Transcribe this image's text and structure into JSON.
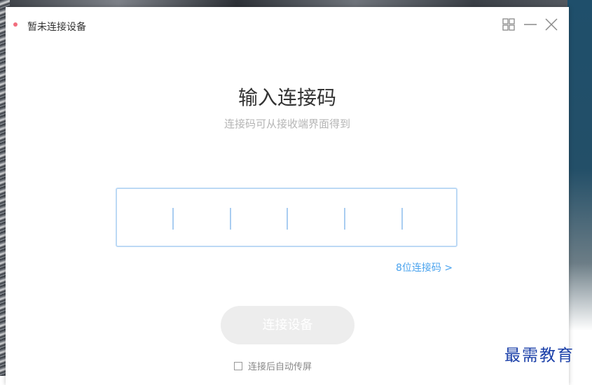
{
  "window": {
    "title": "暂未连接设备",
    "status_color": "#f26d7d",
    "controls": [
      "grid-icon",
      "minimize-icon",
      "close-icon"
    ]
  },
  "main": {
    "heading": "输入连接码",
    "subheading": "连接码可从接收端界面得到",
    "code_slots": 6,
    "code_value": "",
    "code_length_link": "8位连接码 >",
    "connect_button": "连接设备",
    "auto_cast_label": "连接后自动传屏",
    "auto_cast_checked": false
  },
  "watermark": "最需教育",
  "colors": {
    "accent": "#4aa3ee",
    "input_border": "#bcd9f5",
    "button_disabled": "#ededed"
  }
}
